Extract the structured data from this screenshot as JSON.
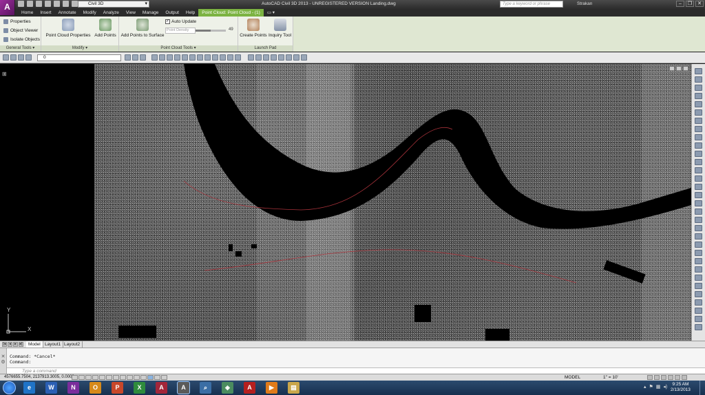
{
  "titlebar": {
    "logo": "A",
    "workspace": "Civil 3D",
    "title": "AutoCAD Civil 3D 2013 - UNREGISTERED VERSION    Landing.dwg",
    "search_placeholder": "Type a keyword or phrase",
    "user": "Strakan",
    "window_buttons": [
      "–",
      "❐",
      "✕"
    ]
  },
  "tabs": [
    "Home",
    "Insert",
    "Annotate",
    "Modify",
    "Analyze",
    "View",
    "Manage",
    "Output",
    "Help"
  ],
  "context_tab": "Point Cloud: Point Cloud - (1)",
  "ribbon": {
    "general_tools": {
      "title": "General Tools ▾",
      "items": [
        "Properties",
        "Object Viewer",
        "Isolate Objects"
      ]
    },
    "modify": {
      "title": "Modify ▾",
      "items": [
        "Point Cloud Properties",
        "Add Points"
      ]
    },
    "point_cloud_tools": {
      "title": "Point Cloud Tools ▾",
      "add_to_surface": "Add Points to Surface",
      "auto_update": "Auto Update",
      "point_density_label": "Point Density",
      "point_density_value": "49",
      "point_density_level": 0.49
    },
    "launch_pad": {
      "title": "Launch Pad",
      "items": [
        "Create Points",
        "Inquiry Tool"
      ]
    }
  },
  "layer": {
    "current": "0"
  },
  "layout_tabs": [
    "Model",
    "Layout1",
    "Layout2"
  ],
  "command": {
    "history": [
      "Command: *Cancel*",
      "Command:"
    ],
    "placeholder": "Type a command"
  },
  "status": {
    "coords": "4576655.7504, 2137913.3005, 0.0000",
    "model": "MODEL",
    "scale": "1\" = 10'"
  },
  "ucs": {
    "y": "Y",
    "x": "X"
  },
  "clock": {
    "time": "9:25 AM",
    "date": "2/13/2013"
  },
  "taskbar": {
    "apps": [
      {
        "name": "internet-explorer",
        "glyph": "e",
        "color": "#1f73c7"
      },
      {
        "name": "word",
        "glyph": "W",
        "color": "#2b5fb4"
      },
      {
        "name": "onenote",
        "glyph": "N",
        "color": "#7a2d9c"
      },
      {
        "name": "outlook",
        "glyph": "O",
        "color": "#d78a1a"
      },
      {
        "name": "powerpoint",
        "glyph": "P",
        "color": "#c8472a"
      },
      {
        "name": "excel",
        "glyph": "X",
        "color": "#2e8b3d"
      },
      {
        "name": "access",
        "glyph": "A",
        "color": "#a3263a"
      },
      {
        "name": "autocad",
        "glyph": "A",
        "color": "#5a5a5a"
      },
      {
        "name": "search",
        "glyph": "⌕",
        "color": "#3b6ea5"
      },
      {
        "name": "installer",
        "glyph": "◈",
        "color": "#4a8c5f"
      },
      {
        "name": "acrobat",
        "glyph": "A",
        "color": "#b51f1f"
      },
      {
        "name": "media",
        "glyph": "▶",
        "color": "#e07b1a"
      },
      {
        "name": "explorer",
        "glyph": "▤",
        "color": "#c9a64a"
      }
    ]
  }
}
